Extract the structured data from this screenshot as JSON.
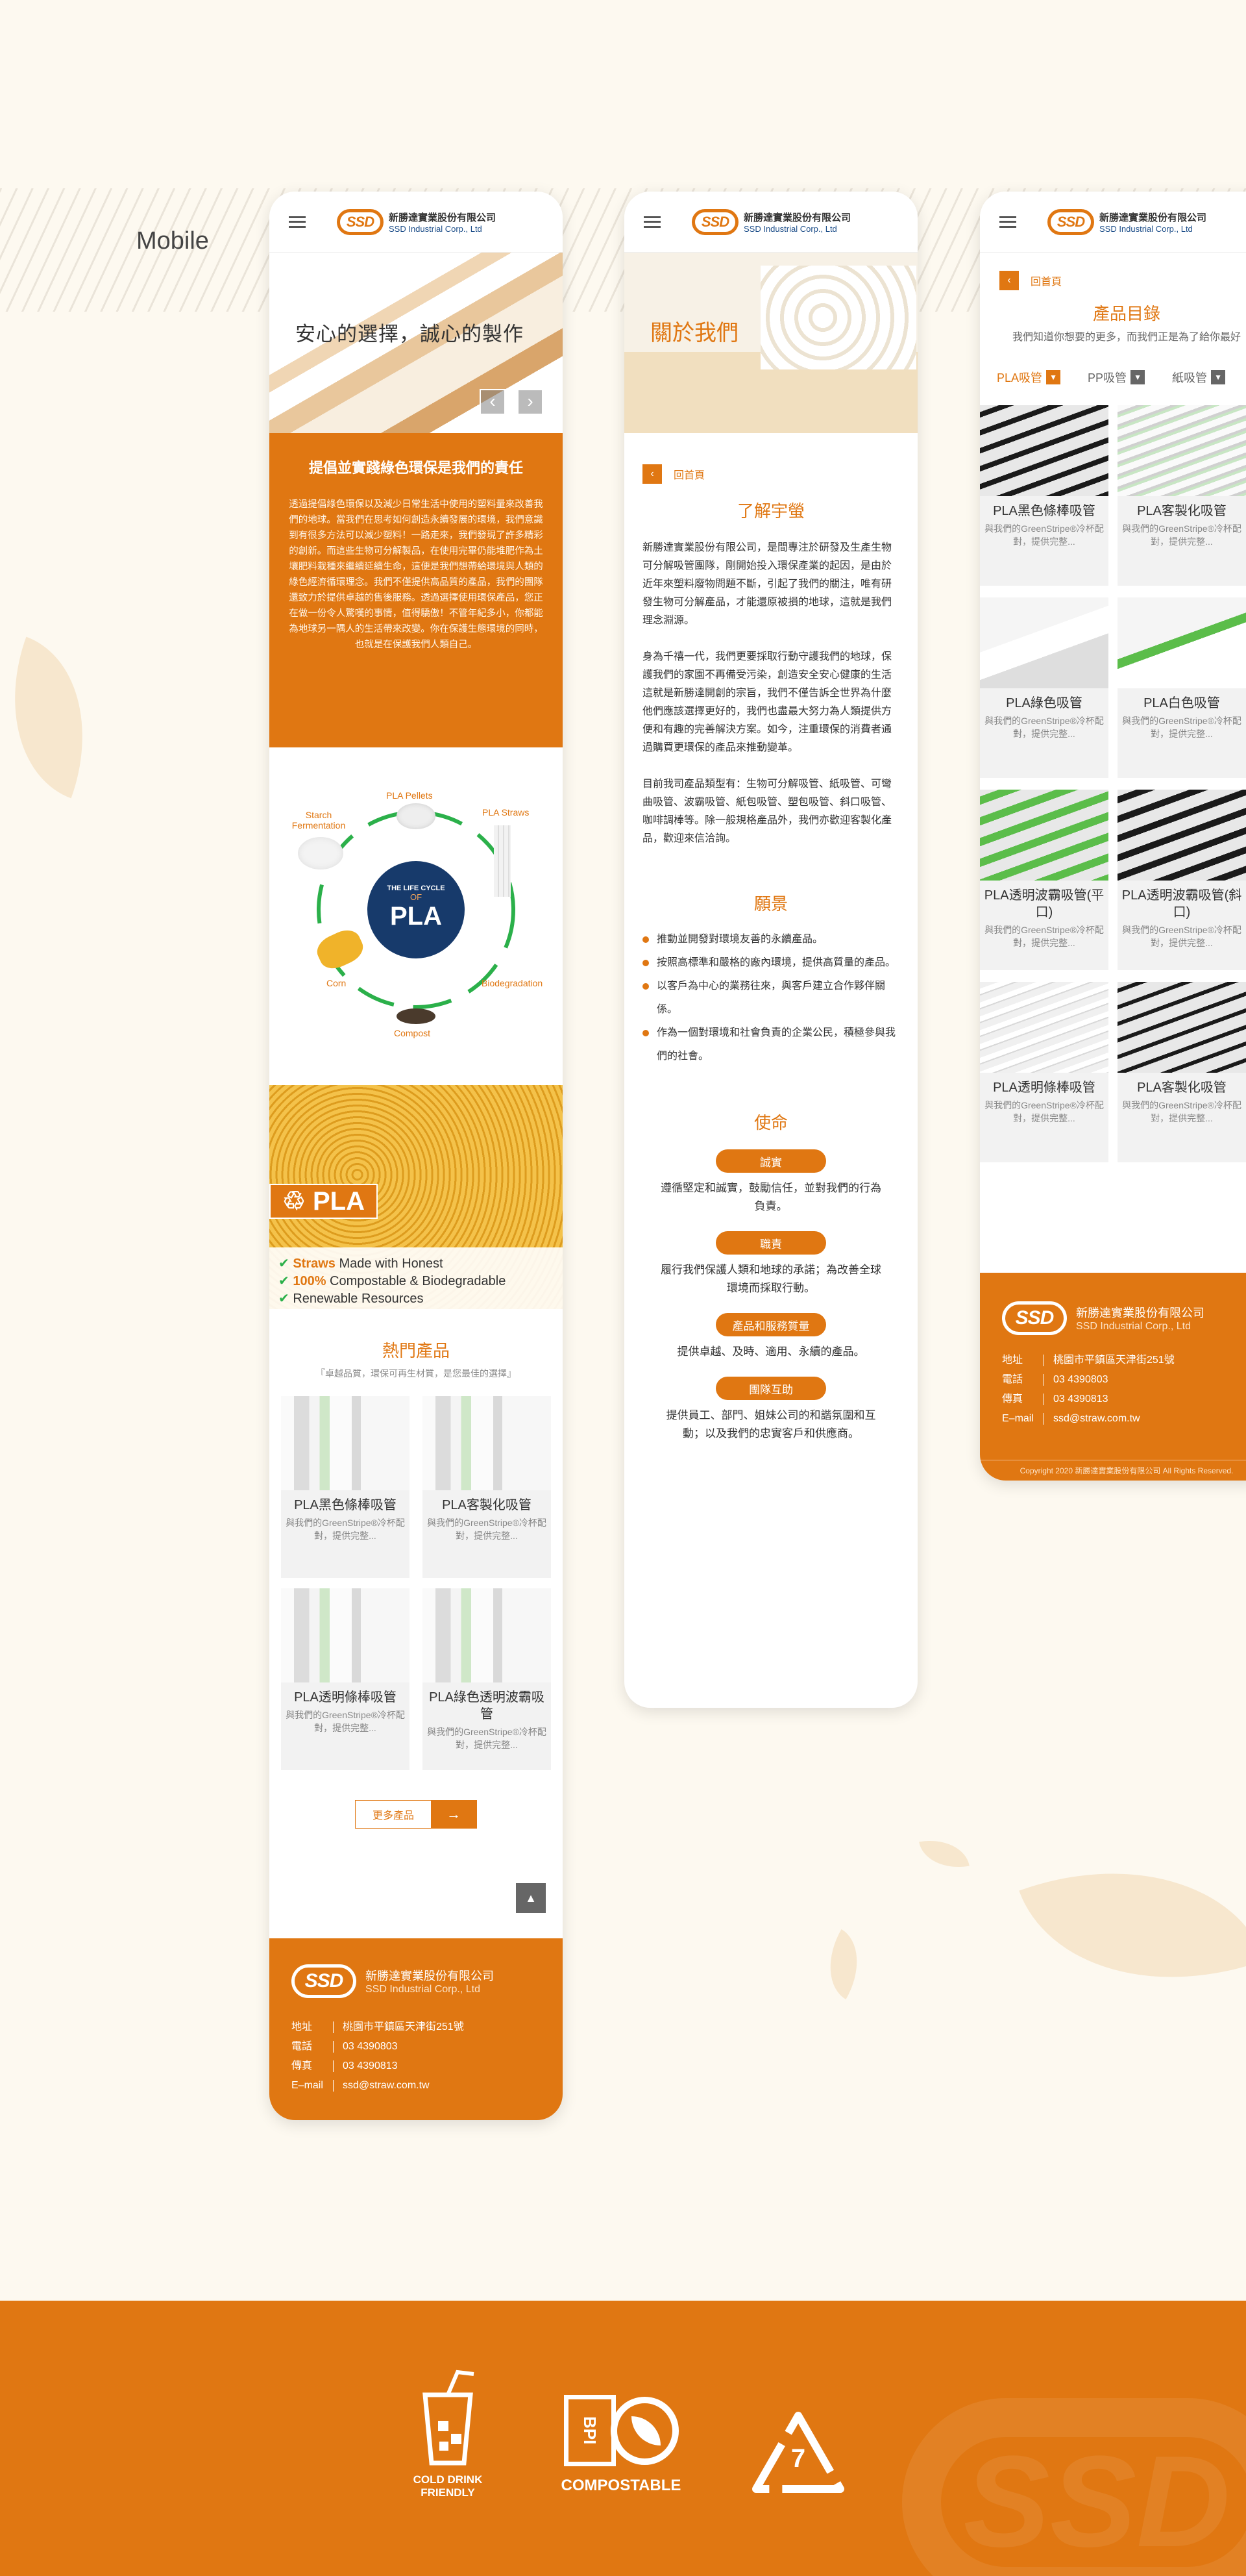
{
  "page": {
    "label": "Mobile"
  },
  "brand": {
    "mark": "SSD",
    "name_zh": "新勝達實業股份有限公司",
    "name_en": "SSD Industrial Corp., Ltd"
  },
  "phone1": {
    "hero_text": "安心的選擇，誠心的製作",
    "prev": "‹",
    "next": "›",
    "intro_title": "提倡並實踐綠色環保是我們的責任",
    "intro_body": "透過提倡綠色環保以及減少日常生活中使用的塑料量來改善我們的地球。當我們在思考如何創造永續發展的環境，我們意識到有很多方法可以減少塑料！一路走來，我們發現了許多精彩的創新。而這些生物可分解製品，在使用完畢仍能堆肥作為土壤肥料栽種來繼續延續生命，這便是我們想帶給環境與人類的綠色經濟循環理念。我們不僅提供高品質的產品，我們的團隊還致力於提供卓越的售後服務。透過選擇使用環保產品，您正在做一份令人驚嘆的事情，值得驕傲！不管年紀多小，你都能為地球另一隅人的生活帶來改變。你在保護生態環境的同時，也就是在保護我們人類自己。",
    "lifecycle": {
      "center_small": "THE LIFE CYCLE",
      "center_of": "OF",
      "center_big": "PLA",
      "pellets": "PLA Pellets",
      "straws": "PLA Straws",
      "bio": "Biodegradation",
      "compost": "Compost",
      "corn": "Corn",
      "starch": "Starch Fermentation"
    },
    "banner": {
      "logo": "PLA",
      "l1a": "Straws",
      "l1b": " Made with Honest",
      "l2a": "100%",
      "l2b": " Compostable & Biodegradable",
      "l3": "Renewable Resources"
    },
    "hot_title": "熱門產品",
    "hot_sub": "『卓越品質，環保可再生材質，是您最佳的選擇』",
    "products": [
      {
        "name": "PLA黑色條棒吸管",
        "desc": "與我們的GreenStripe®冷杯配對，提供完整..."
      },
      {
        "name": "PLA客製化吸管",
        "desc": "與我們的GreenStripe®冷杯配對，提供完整..."
      },
      {
        "name": "PLA透明條棒吸管",
        "desc": "與我們的GreenStripe®冷杯配對，提供完整..."
      },
      {
        "name": "PLA綠色透明波霸吸管",
        "desc": "與我們的GreenStripe®冷杯配對，提供完整..."
      }
    ],
    "more": "更多產品",
    "more_arrow": "→",
    "top": "▲"
  },
  "footer": {
    "addr_k": "地址",
    "addr": "桃園市平鎮區天津街251號",
    "tel_k": "電話",
    "tel": "03 4390803",
    "fax_k": "傳真",
    "fax": "03 4390813",
    "mail_k": "E–mail",
    "mail": "ssd@straw.com.tw",
    "copyright": "Copyright 2020 新勝達實業股份有限公司 All Rights Reserved."
  },
  "phone2": {
    "hero_title": "關於我們",
    "back": "回首頁",
    "about_title": "了解宇螢",
    "p1": "新勝達實業股份有限公司，是間專注於研發及生產生物可分解吸管團隊，剛開始投入環保產業的起因，是由於近年來塑料廢物問題不斷，引起了我們的關注，唯有研發生物可分解產品，才能還原被損的地球，這就是我們理念淵源。",
    "p2": "身為千禧一代，我們更要採取行動守護我們的地球，保護我們的家園不再備受污染，創造安全安心健康的生活這就是新勝達開創的宗旨，我們不僅告訴全世界為什麼他們應該選擇更好的，我們也盡最大努力為人類提供方便和有趣的完善解決方案。如今，注重環保的消費者通過購買更環保的產品來推動變革。",
    "p3": "目前我司產品類型有：生物可分解吸管、紙吸管、可彎曲吸管、波霸吸管、紙包吸管、塑包吸管、斜口吸管、咖啡調棒等。除一般規格產品外，我們亦歡迎客製化產品，歡迎來信洽詢。",
    "vision_title": "願景",
    "vision": [
      "推動並開發對環境友善的永續產品。",
      "按照高標準和嚴格的廠內環境，提供高質量的產品。",
      "以客戶為中心的業務往來，與客戶建立合作夥伴關係。",
      "作為一個對環境和社會負責的企業公民，積極參與我們的社會。"
    ],
    "mission_title": "使命",
    "missions": [
      {
        "tag": "誠實",
        "text": "遵循堅定和誠實，鼓勵信任，並對我們的行為負責。"
      },
      {
        "tag": "職責",
        "text": "履行我們保護人類和地球的承諾；為改善全球環境而採取行動。"
      },
      {
        "tag": "產品和服務質量",
        "text": "提供卓越、及時、適用、永續的產品。"
      },
      {
        "tag": "團隊互助",
        "text": "提供員工、部門、姐妹公司的和諧氛圍和互動；以及我們的忠實客戶和供應商。"
      }
    ]
  },
  "phone3": {
    "back": "回首頁",
    "title": "產品目錄",
    "subtitle": "我們知道你想要的更多，而我們正是為了給你最好",
    "tabs": [
      "PLA吸管",
      "PP吸管",
      "紙吸管"
    ],
    "products": [
      {
        "name": "PLA黑色條棒吸管",
        "desc": "與我們的GreenStripe®冷杯配對，提供完整..."
      },
      {
        "name": "PLA客製化吸管",
        "desc": "與我們的GreenStripe®冷杯配對，提供完整..."
      },
      {
        "name": "PLA綠色吸管",
        "desc": "與我們的GreenStripe®冷杯配對，提供完整..."
      },
      {
        "name": "PLA白色吸管",
        "desc": "與我們的GreenStripe®冷杯配對，提供完整..."
      },
      {
        "name": "PLA透明波霸吸管(平口)",
        "desc": "與我們的GreenStripe®冷杯配對，提供完整..."
      },
      {
        "name": "PLA透明波霸吸管(斜口)",
        "desc": "與我們的GreenStripe®冷杯配對，提供完整..."
      },
      {
        "name": "PLA透明條棒吸管",
        "desc": "與我們的GreenStripe®冷杯配對，提供完整..."
      },
      {
        "name": "PLA客製化吸管",
        "desc": "與我們的GreenStripe®冷杯配對，提供完整..."
      }
    ]
  },
  "badges": {
    "cold_1": "COLD DRINK",
    "cold_2": "FRIENDLY",
    "bpi": "BPI",
    "bpi_label": "COMPOSTABLE",
    "recycle_num": "7"
  },
  "colors": {
    "accent": "#e07712",
    "bg": "#fdf9f0"
  }
}
